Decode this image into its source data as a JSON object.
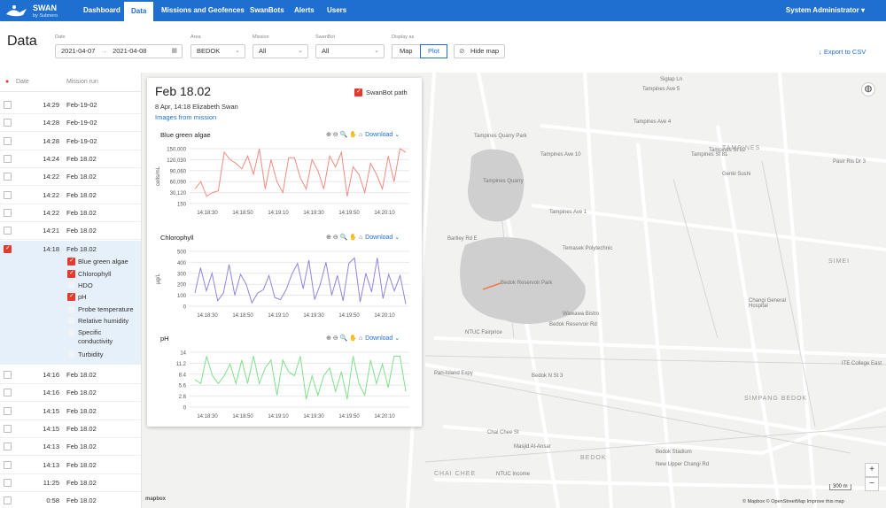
{
  "app": {
    "name": "SWAN",
    "byline": "by Subnero",
    "user": "System Administrator ▾"
  },
  "nav": [
    "Dashboard",
    "Data",
    "Missions and Geofences",
    "SwanBots",
    "Alerts",
    "Users"
  ],
  "page_title": "Data",
  "filters": {
    "date_label": "Date",
    "date_from": "2021-04-07",
    "date_to": "2021-04-08",
    "area_label": "Area",
    "area_value": "BEDOK",
    "mission_label": "Mission",
    "mission_value": "All",
    "swanbot_label": "SwanBot",
    "swanbot_value": "All",
    "display_label": "Display as",
    "display_map": "Map",
    "display_plot": "Plot",
    "hide_map": "Hide map",
    "export": "↓ Export to CSV"
  },
  "table": {
    "headers": [
      "Date",
      "Mission run"
    ],
    "rows_before": [
      {
        "time": "14:29",
        "mission": "Feb-19-02"
      },
      {
        "time": "14:28",
        "mission": "Feb-19-02"
      },
      {
        "time": "14:28",
        "mission": "Feb-19-02"
      },
      {
        "time": "14:24",
        "mission": "Feb 18.02"
      },
      {
        "time": "14:22",
        "mission": "Feb 18.02"
      },
      {
        "time": "14:22",
        "mission": "Feb 18.02"
      },
      {
        "time": "14:22",
        "mission": "Feb 18.02"
      },
      {
        "time": "14:21",
        "mission": "Feb 18.02"
      }
    ],
    "selected": {
      "time": "14:18",
      "mission": "Feb 18.02"
    },
    "sub_options": [
      {
        "label": "Blue green algae",
        "checked": true
      },
      {
        "label": "Chlorophyll",
        "checked": true
      },
      {
        "label": "HDO",
        "checked": false
      },
      {
        "label": "pH",
        "checked": true
      },
      {
        "label": "Probe temperature",
        "checked": false
      },
      {
        "label": "Relative humidity",
        "checked": false
      },
      {
        "label": "Specific conductivity",
        "checked": false
      },
      {
        "label": "Turbidity",
        "checked": false
      }
    ],
    "rows_after": [
      {
        "time": "14:16",
        "mission": "Feb 18.02"
      },
      {
        "time": "14:16",
        "mission": "Feb 18.02"
      },
      {
        "time": "14:15",
        "mission": "Feb 18.02"
      },
      {
        "time": "14:15",
        "mission": "Feb 18.02"
      },
      {
        "time": "14:13",
        "mission": "Feb 18.02"
      },
      {
        "time": "14:13",
        "mission": "Feb 18.02"
      },
      {
        "time": "11:25",
        "mission": "Feb 18.02"
      },
      {
        "time": "0:58",
        "mission": "Feb 18.02"
      }
    ]
  },
  "card": {
    "title": "Feb 18.02",
    "subtitle": "8 Apr, 14:18   Elizabeth Swan",
    "link": "Images from mission",
    "path_label": "SwanBot path",
    "download": "Download ⌄",
    "tools": "⊕ ⊖ 🔍 ✋ ⌂"
  },
  "chart_data": [
    {
      "type": "line",
      "title": "Blue green algae",
      "ylabel": "cells/mL",
      "color": "#f28b82",
      "yticks": [
        "150,000",
        "120,030",
        "90,060",
        "60,090",
        "30,120",
        "150"
      ],
      "ylim": [
        150,
        150000
      ],
      "xticks": [
        "14:18:30",
        "14:18:50",
        "14:19:10",
        "14:19:30",
        "14:19:50",
        "14:20:10"
      ],
      "values": [
        40000,
        60000,
        20000,
        30000,
        35000,
        140000,
        120000,
        110000,
        95000,
        130000,
        80000,
        150000,
        40000,
        120000,
        60000,
        30000,
        125000,
        125000,
        70000,
        40000,
        120000,
        90000,
        40000,
        130000,
        100000,
        140000,
        20000,
        100000,
        80000,
        30000,
        110000,
        80000,
        40000,
        130000,
        60000,
        150000,
        140000
      ]
    },
    {
      "type": "line",
      "title": "Chlorophyll",
      "ylabel": "µg/L",
      "color": "#8f85e0",
      "yticks": [
        "500",
        "400",
        "300",
        "200",
        "100",
        "0"
      ],
      "ylim": [
        0,
        500
      ],
      "xticks": [
        "14:18:30",
        "14:18:50",
        "14:19:10",
        "14:19:30",
        "14:19:50",
        "14:20:10"
      ],
      "values": [
        120,
        350,
        140,
        300,
        50,
        120,
        380,
        100,
        290,
        200,
        30,
        120,
        150,
        280,
        80,
        60,
        150,
        290,
        390,
        160,
        420,
        60,
        200,
        400,
        100,
        280,
        50,
        390,
        440,
        40,
        300,
        130,
        440,
        70,
        290,
        140,
        280,
        20
      ]
    },
    {
      "type": "line",
      "title": "pH",
      "color": "#7fe08a",
      "yticks": [
        "14",
        "11.2",
        "8.4",
        "5.6",
        "2.8",
        "0"
      ],
      "ylim": [
        0,
        14
      ],
      "xticks": [
        "14:18:30",
        "14:18:50",
        "14:19:10",
        "14:19:30",
        "14:19:50",
        "14:20:10"
      ],
      "values": [
        7,
        6,
        13,
        8,
        6,
        8,
        11,
        6,
        12,
        6,
        13,
        6,
        10,
        12,
        3,
        12,
        9,
        8,
        13,
        2,
        8,
        3,
        8,
        10,
        4,
        9,
        2,
        13,
        6,
        3,
        12,
        6,
        11,
        5,
        13,
        13,
        4
      ]
    }
  ],
  "map": {
    "labels": [
      "Siglap Ln",
      "Tampines Ave 5",
      "Tampines Quarry Park",
      "Tampines Quarry",
      "Tampines Ave 10",
      "Tampines Ave 4",
      "Tampines Ave 1",
      "Temasek Polytechnic",
      "Bedok Reservoir Park",
      "Wawawa Bistro",
      "Bedok Reservoir Rd",
      "NTUC Fairprice",
      "Pan-Island Expy",
      "Bedok N St 3",
      "Chai Chee St",
      "Masjid Al-Ansar",
      "Bedok Stadium",
      "CHAI CHEE",
      "BEDOK",
      "SIMPANG BEDOK",
      "TAMPINES",
      "SIMEI",
      "Changi General Hospital",
      "Bartley Rd E",
      "Genki Sushi",
      "ITE College East",
      "New Upper Changi Rd",
      "NTUC Income",
      "Tampines St 82",
      "Tampines St 81",
      "Pasir Ris Dr 3"
    ],
    "attribution": "© Mapbox © OpenStreetMap  Improve this map",
    "brand": "mapbox",
    "scale": "300 m"
  }
}
